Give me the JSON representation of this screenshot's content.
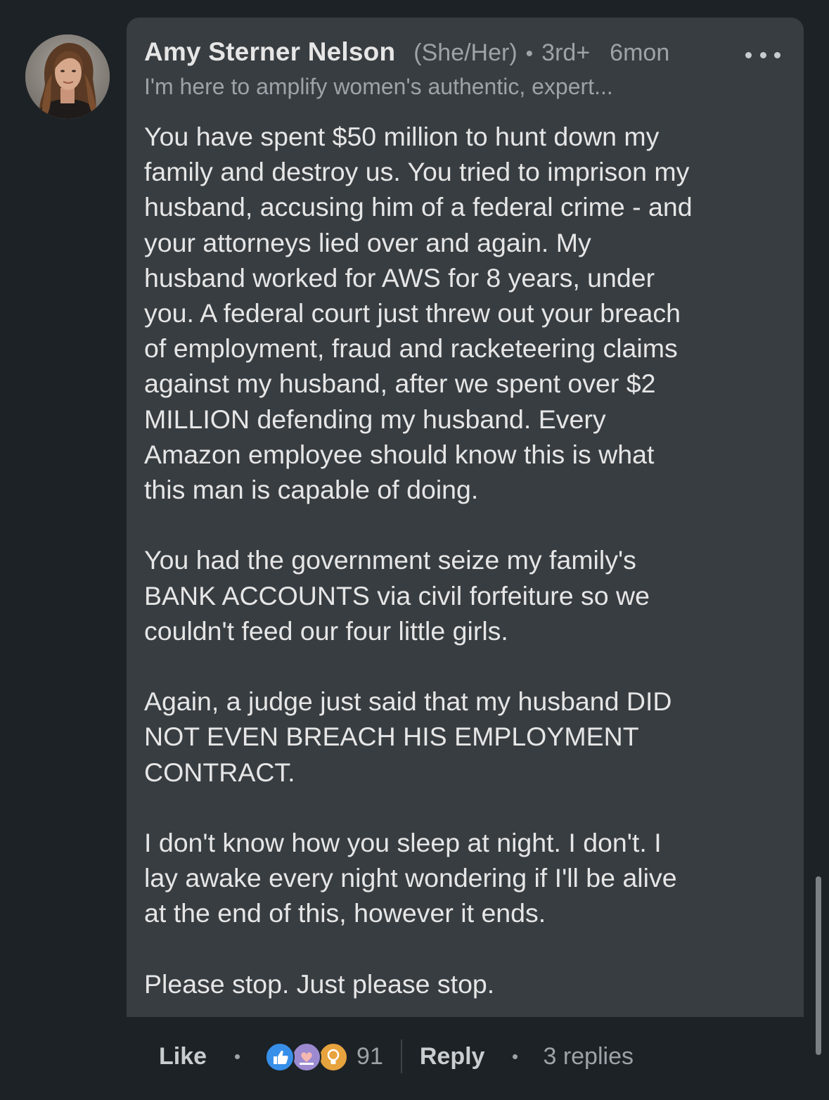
{
  "comment": {
    "author_name": "Amy Sterner Nelson",
    "pronouns": "(She/Her)",
    "separator": "•",
    "connection_degree": "3rd+",
    "time_ago": "6mon",
    "headline": "I'm here to amplify women's authentic, expert...",
    "paragraphs": [
      "You have spent $50 million to hunt down my\nfamily and destroy us. You tried to imprison my\nhusband, accusing him of a federal crime - and\nyour attorneys lied over and again. My\nhusband worked for AWS for 8 years, under\nyou. A federal court just threw out your breach\nof employment, fraud and racketeering claims\nagainst my husband, after we spent over $2\nMILLION defending my husband. Every\nAmazon employee should know this is what\nthis man is capable of doing.",
      "You had the government seize my family's\nBANK ACCOUNTS via civil forfeiture so we\ncouldn't feed our four little girls.",
      "Again, a judge just said that my husband DID\nNOT EVEN BREACH HIS EMPLOYMENT\nCONTRACT.",
      "I don't know how you sleep at night. I don't. I\nlay awake every night wondering if I'll be alive\nat the end of this, however it ends.",
      "Please stop. Just please stop."
    ]
  },
  "actions": {
    "like_label": "Like",
    "reaction_icons": [
      "like-icon",
      "love-icon",
      "insightful-icon"
    ],
    "reaction_count": "91",
    "reply_label": "Reply",
    "replies_label": "3 replies"
  },
  "colors": {
    "background": "#1d2226",
    "bubble": "#383d41",
    "primary_text": "#e6e6e6",
    "secondary_text": "#9da3a8",
    "like_blue": "#378fe9",
    "love_purple": "#9c8ad1",
    "insightful_gold": "#e7a33e"
  }
}
